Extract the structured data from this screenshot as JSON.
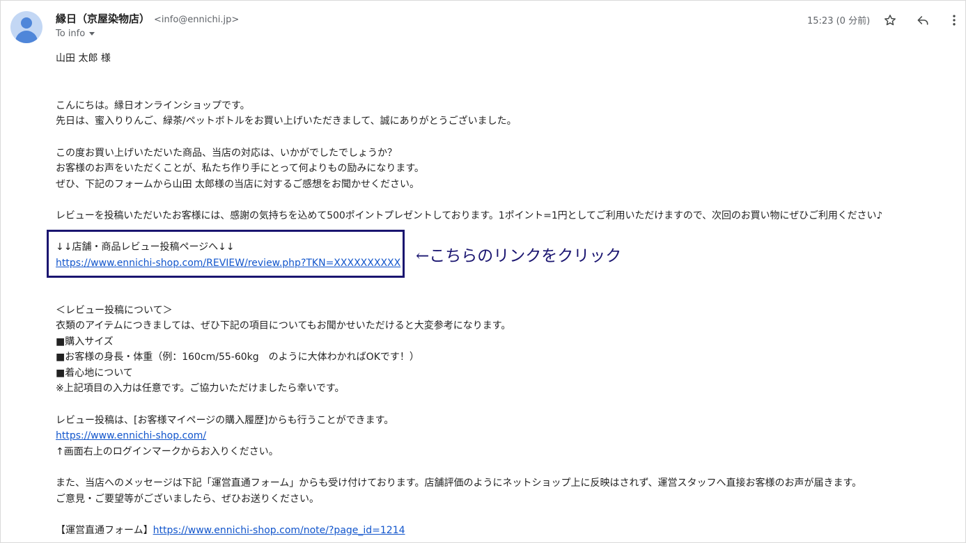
{
  "header": {
    "sender_name": "縁日（京屋染物店）",
    "sender_email": "<info@ennichi.jp>",
    "to_label": "To info",
    "time": "15:23 (0 分前)"
  },
  "icons": {
    "star": "star-icon",
    "reply": "reply-icon",
    "more": "more-vert-icon",
    "avatar": "avatar-icon"
  },
  "body": {
    "greeting": "山田 太郎 様",
    "p1_l1": "こんにちは。縁日オンラインショップです。",
    "p1_l2": "先日は、蜜入りりんご、緑茶/ペットボトルをお買い上げいただきまして、誠にありがとうございました。",
    "p2_l1": "この度お買い上げいただいた商品、当店の対応は、いかがでしたでしょうか？",
    "p2_l2": "お客様のお声をいただくことが、私たち作り手にとって何よりもの励みになります。",
    "p2_l3": "ぜひ、下記のフォームから山田 太郎様の当店に対するご感想をお聞かせください。",
    "p3_l1": "レビューを投稿いただいたお客様には、感謝の気持ちを込めて500ポイントプレゼントしております。1ポイント=1円としてご利用いただけますので、次回のお買い物にぜひご利用ください♪",
    "review_heading": "↓↓店舗・商品レビュー投稿ページへ↓↓",
    "review_url": "https://www.ennichi-shop.com/REVIEW/review.php?TKN=XXXXXXXXXX",
    "about_heading": "＜レビュー投稿について＞",
    "about_l1": "衣類のアイテムにつきましては、ぜひ下記の項目についてもお聞かせいただけると大変参考になります。",
    "about_l2": "■購入サイズ",
    "about_l3": "■お客様の身長・体重（例：160cm/55-60kg　のように大体わかればOKです！）",
    "about_l4": "■着心地について",
    "about_l5": "※上記項目の入力は任意です。ご協力いただけましたら幸いです。",
    "mypage_l1": "レビュー投稿は、[お客様マイページの購入履歴]からも行うことができます。",
    "mypage_url": "https://www.ennichi-shop.com/",
    "mypage_l3": "↑画面右上のログインマークからお入りください。",
    "msg_l1": "また、当店へのメッセージは下記「運営直通フォーム」からも受け付けております。店舗評価のようにネットショップ上に反映はされず、運営スタッフへ直接お客様のお声が届きます。",
    "msg_l2": "ご意見・ご要望等がございましたら、ぜひお送りください。",
    "form_label": "【運営直通フォーム】",
    "form_url": "https://www.ennichi-shop.com/note/?page_id=1214"
  },
  "annotation": {
    "text": "←こちらのリンクをクリック",
    "color": "#1a1570"
  },
  "colors": {
    "link": "#1155cc",
    "avatar_bg": "#c3d7f4",
    "avatar_fg": "#4f86d9"
  }
}
